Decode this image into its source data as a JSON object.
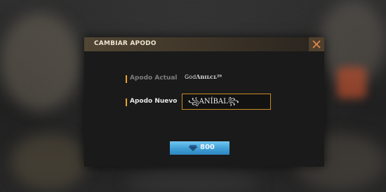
{
  "dialog": {
    "title": "CAMBIAR APODO",
    "close_icon": "close-icon"
  },
  "current_nickname": {
    "label": "Apodo Actual",
    "value_prefix": "God",
    "value_suffix": "Ʌnɪʟᴄʟ²⁰"
  },
  "new_nickname": {
    "label": "Apodo Nuevo",
    "value": "꧁ANÍBAL꧂"
  },
  "cost_button": {
    "icon": "diamond-icon",
    "value": "800"
  },
  "colors": {
    "accent": "#e7a42e",
    "button": "#3f9ed6"
  }
}
